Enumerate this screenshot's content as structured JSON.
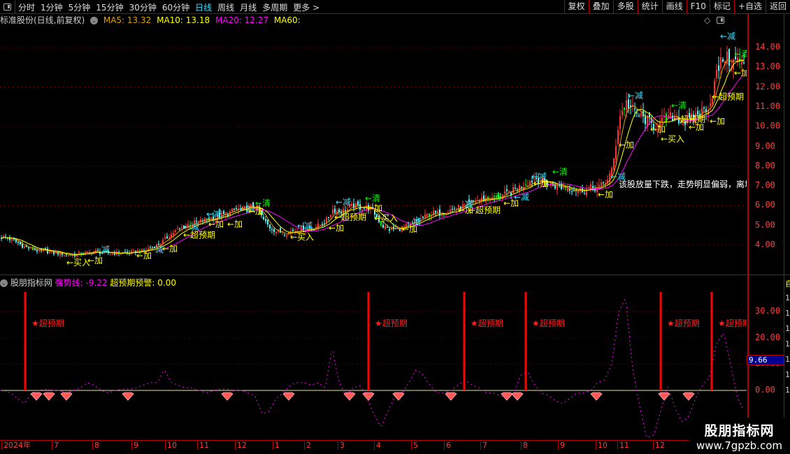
{
  "toolbar": {
    "periods": [
      "分时",
      "1分钟",
      "5分钟",
      "15分钟",
      "30分钟",
      "60分钟",
      "日线",
      "周线",
      "月线",
      "多周期",
      "更多 >"
    ],
    "active_period": "日线",
    "right_buttons": [
      "复权",
      "叠加",
      "多股",
      "统计",
      "画线",
      "F10",
      "标记",
      "+自选",
      "返回"
    ]
  },
  "header": {
    "title": "标准股份(日线,前复权)",
    "ma5": "MA5: 13.32",
    "ma10": "MA10: 13.18",
    "ma20": "MA20: 12.27",
    "ma60": "MA60:",
    "colors": {
      "ma5": "#e0a000",
      "ma10": "#ffff00",
      "ma20": "#ff00ff",
      "ma60": "#ffff00"
    }
  },
  "indicator": {
    "name": "股朋指标网",
    "line1": "强势线: -9.22",
    "line2": "超预期预警: 0.00",
    "current": "9.66",
    "signal_label": "★超预期"
  },
  "price_axis": [
    "14.00",
    "13.00",
    "12.00",
    "11.00",
    "10.00",
    "9.00",
    "8.00",
    "7.00",
    "6.00",
    "5.00",
    "4.00"
  ],
  "indicator_axis": [
    "30.00",
    "20.00",
    "10.00",
    "0.00"
  ],
  "time_axis": [
    "2024年",
    "7",
    "8",
    "9",
    "10",
    "11",
    "12",
    "1",
    "2",
    "3",
    "4",
    "5",
    "6",
    "7",
    "8",
    "9",
    "10",
    "11",
    "12"
  ],
  "comment": "该股放量下跌，走势明显偏弱，离场",
  "right_column": [
    "自",
    "1",
    "1",
    "1",
    "1",
    "1",
    "1",
    "1"
  ],
  "watermark": {
    "title": "股朋指标网",
    "url": "www.7gpzb.com"
  },
  "chart_data": [
    {
      "type": "candlestick",
      "title": "标准股份 日线",
      "ylim": [
        3,
        15
      ],
      "closes": [
        4.4,
        4.3,
        4.1,
        3.9,
        3.8,
        3.7,
        3.7,
        3.6,
        3.6,
        3.5,
        3.5,
        3.6,
        3.6,
        3.7,
        3.6,
        3.6,
        3.6,
        3.6,
        3.6,
        3.7,
        3.7,
        3.9,
        4.0,
        4.3,
        4.6,
        4.8,
        5.0,
        5.1,
        5.2,
        5.3,
        5.4,
        5.5,
        5.6,
        5.8,
        5.8,
        5.9,
        6.0,
        5.3,
        4.9,
        4.7,
        4.6,
        4.7,
        4.8,
        4.8,
        4.9,
        5.0,
        5.2,
        5.8,
        5.7,
        5.8,
        6.0,
        5.9,
        5.9,
        5.6,
        5.0,
        4.8,
        4.8,
        4.9,
        5.0,
        5.2,
        5.4,
        5.6,
        5.6,
        5.7,
        5.8,
        5.9,
        6.0,
        6.2,
        6.3,
        6.4,
        6.3,
        6.5,
        6.6,
        6.8,
        7.0,
        7.2,
        7.4,
        7.2,
        7.1,
        7.0,
        6.9,
        6.9,
        6.8,
        6.8,
        6.9,
        6.9,
        7.2,
        7.8,
        10.5,
        11.2,
        10.8,
        10.5,
        10.3,
        10.0,
        10.2,
        10.4,
        10.6,
        10.2,
        10.3,
        10.6,
        10.8,
        11.2,
        12.8,
        13.6,
        13.2,
        13.4,
        12.9
      ],
      "annotations": [
        {
          "i": 9,
          "p": 3.15,
          "t": "←买入",
          "c": "#ffff00"
        },
        {
          "i": 12,
          "p": 3.25,
          "t": "←加",
          "c": "#ffff00"
        },
        {
          "i": 14,
          "p": 3.8,
          "t": "减",
          "c": "#36e0ff"
        },
        {
          "i": 19,
          "p": 3.5,
          "t": "←加",
          "c": "#ffff00"
        },
        {
          "i": 21.7,
          "p": 3.8,
          "t": "减",
          "c": "#36e0ff"
        },
        {
          "i": 22.7,
          "p": 3.85,
          "t": "←加",
          "c": "#ffff00"
        },
        {
          "i": 25.7,
          "p": 4.55,
          "t": "←超预期",
          "c": "#ffff00"
        },
        {
          "i": 25.8,
          "p": 4.95,
          "t": "←减",
          "c": "#36e0ff"
        },
        {
          "i": 29,
          "p": 5.6,
          "t": "←减",
          "c": "#36e0ff"
        },
        {
          "i": 29.3,
          "p": 5.1,
          "t": "←加",
          "c": "#ffff00"
        },
        {
          "i": 32,
          "p": 5.1,
          "t": "←加",
          "c": "#ffff00"
        },
        {
          "i": 33.8,
          "p": 5.85,
          "t": "←减",
          "c": "#36e0ff"
        },
        {
          "i": 35,
          "p": 5.75,
          "t": "←加",
          "c": "#ffff00"
        },
        {
          "i": 36,
          "p": 6.15,
          "t": "←清",
          "c": "#00ff00"
        },
        {
          "i": 42,
          "p": 5.0,
          "t": "←减",
          "c": "#36e0ff"
        },
        {
          "i": 41,
          "p": 4.45,
          "t": "←买入",
          "c": "#ffff00"
        },
        {
          "i": 46.5,
          "p": 4.9,
          "t": "←加",
          "c": "#ffff00"
        },
        {
          "i": 47.3,
          "p": 5.45,
          "t": "←超预期",
          "c": "#ffff00"
        },
        {
          "i": 47.5,
          "p": 6.2,
          "t": "←减",
          "c": "#36e0ff"
        },
        {
          "i": 51.7,
          "p": 6.4,
          "t": "←清",
          "c": "#00ff00"
        },
        {
          "i": 52,
          "p": 5.9,
          "t": "←加",
          "c": "#ffff00"
        },
        {
          "i": 53,
          "p": 5.4,
          "t": "←买入",
          "c": "#ffff00"
        },
        {
          "i": 57,
          "p": 4.85,
          "t": "←加",
          "c": "#ffff00"
        },
        {
          "i": 58.5,
          "p": 5.2,
          "t": "减",
          "c": "#36e0ff"
        },
        {
          "i": 65,
          "p": 5.8,
          "t": "←加",
          "c": "#ffff00"
        },
        {
          "i": 66.5,
          "p": 5.8,
          "t": "←超预期",
          "c": "#ffff00"
        },
        {
          "i": 66,
          "p": 6.1,
          "t": "减",
          "c": "#36e0ff"
        },
        {
          "i": 70,
          "p": 6.45,
          "t": "清",
          "c": "#00ff00"
        },
        {
          "i": 71.5,
          "p": 6.15,
          "t": "←加",
          "c": "#ffff00"
        },
        {
          "i": 73,
          "p": 6.45,
          "t": "←减",
          "c": "#36e0ff"
        },
        {
          "i": 75.5,
          "p": 7.5,
          "t": "←减",
          "c": "#36e0ff"
        },
        {
          "i": 75.8,
          "p": 7.15,
          "t": "←加",
          "c": "#ffff00"
        },
        {
          "i": 78.5,
          "p": 7.75,
          "t": "←清",
          "c": "#00ff00"
        },
        {
          "i": 86.8,
          "p": 7.5,
          "t": "←减",
          "c": "#36e0ff"
        },
        {
          "i": 85,
          "p": 6.6,
          "t": "←加",
          "c": "#ffff00"
        },
        {
          "i": 88,
          "p": 9.1,
          "t": "←加",
          "c": "#ffff00"
        },
        {
          "i": 89.3,
          "p": 11.6,
          "t": "←减",
          "c": "#36e0ff"
        },
        {
          "i": 95.5,
          "p": 11.1,
          "t": "←清",
          "c": "#00ff00"
        },
        {
          "i": 95.8,
          "p": 10.4,
          "t": "←超预期",
          "c": "#ffff00"
        },
        {
          "i": 92.5,
          "p": 9.9,
          "t": "←加",
          "c": "#ffff00"
        },
        {
          "i": 94,
          "p": 9.4,
          "t": "←买入",
          "c": "#ffff00"
        },
        {
          "i": 98,
          "p": 10.0,
          "t": "←加",
          "c": "#ffff00"
        },
        {
          "i": 102.5,
          "p": 14.6,
          "t": "←减",
          "c": "#36e0ff"
        },
        {
          "i": 104.5,
          "p": 13.7,
          "t": "←清",
          "c": "#00ff00"
        },
        {
          "i": 104.5,
          "p": 12.75,
          "t": "←加",
          "c": "#ffff00"
        },
        {
          "i": 101.3,
          "p": 11.55,
          "t": "←超预期",
          "c": "#ffff00"
        },
        {
          "i": 101,
          "p": 10.3,
          "t": "←加",
          "c": "#ffff00"
        }
      ]
    },
    {
      "type": "line",
      "title": "股朋指标网",
      "ylim": [
        -20,
        40
      ],
      "strength": [
        0,
        -1,
        -3,
        -5,
        -1,
        0,
        0.5,
        0,
        0,
        -1,
        0,
        1,
        3,
        2,
        0,
        -1,
        0,
        0.5,
        0.5,
        1,
        2,
        3,
        3,
        8,
        3,
        2,
        1,
        1,
        0,
        -1,
        0,
        0.5,
        0.5,
        0,
        0,
        -1,
        -2,
        -9,
        -8,
        -3,
        -1,
        2,
        3,
        3,
        2,
        3,
        1,
        16,
        3,
        -2,
        1,
        2,
        -3,
        -9,
        -14,
        -8,
        -2,
        -1,
        3,
        8,
        6,
        2,
        -1,
        -1,
        0,
        2,
        4,
        2,
        1,
        -1,
        -1,
        -2,
        -3,
        -1,
        6,
        7,
        2,
        -1,
        -2,
        -4,
        -5,
        -3,
        -1,
        -1,
        0,
        3,
        4,
        10,
        30,
        35,
        8,
        -6,
        -18,
        -17,
        -8,
        2,
        -6,
        -12,
        -10,
        -3,
        2,
        5,
        18,
        22,
        10,
        -3,
        -8
      ],
      "signals": [
        3.1,
        52.2,
        65.9,
        74.7,
        94.0,
        101.3
      ],
      "gems": [
        4.7,
        6.5,
        9,
        17.8,
        32,
        40.8,
        49.5,
        52.2,
        56.5,
        64,
        72,
        73.5,
        84.8,
        94.5,
        98
      ]
    }
  ]
}
